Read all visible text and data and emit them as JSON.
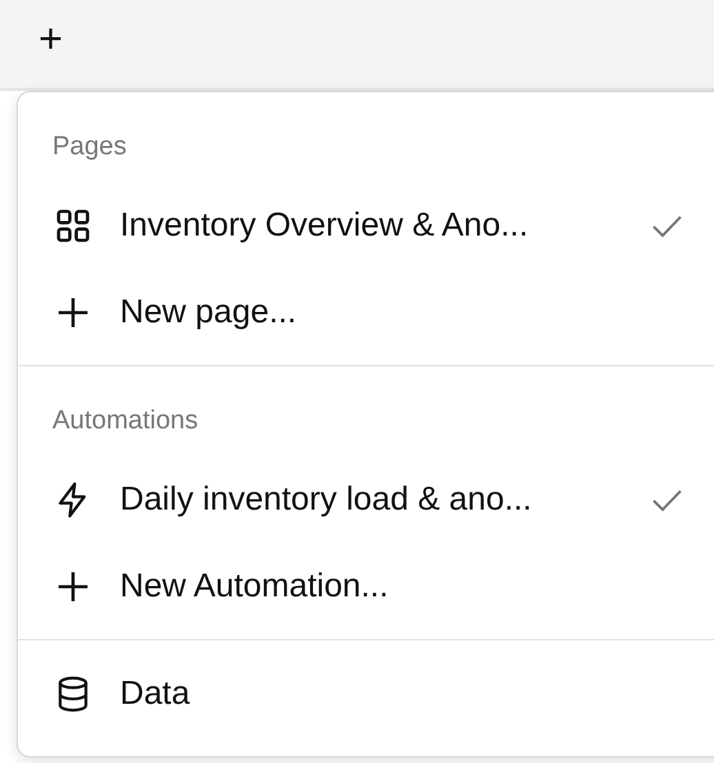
{
  "toolbar": {
    "add_button": "+"
  },
  "menu": {
    "sections": [
      {
        "title": "Pages",
        "items": [
          {
            "kind": "grid",
            "label": "Inventory Overview & Ano...",
            "selected": true
          },
          {
            "kind": "plus",
            "label": "New page...",
            "selected": false
          }
        ]
      },
      {
        "title": "Automations",
        "items": [
          {
            "kind": "bolt",
            "label": "Daily inventory load & ano...",
            "selected": true
          },
          {
            "kind": "plus",
            "label": "New Automation...",
            "selected": false
          }
        ]
      },
      {
        "items": [
          {
            "kind": "database",
            "label": "Data",
            "selected": false
          }
        ]
      }
    ]
  }
}
